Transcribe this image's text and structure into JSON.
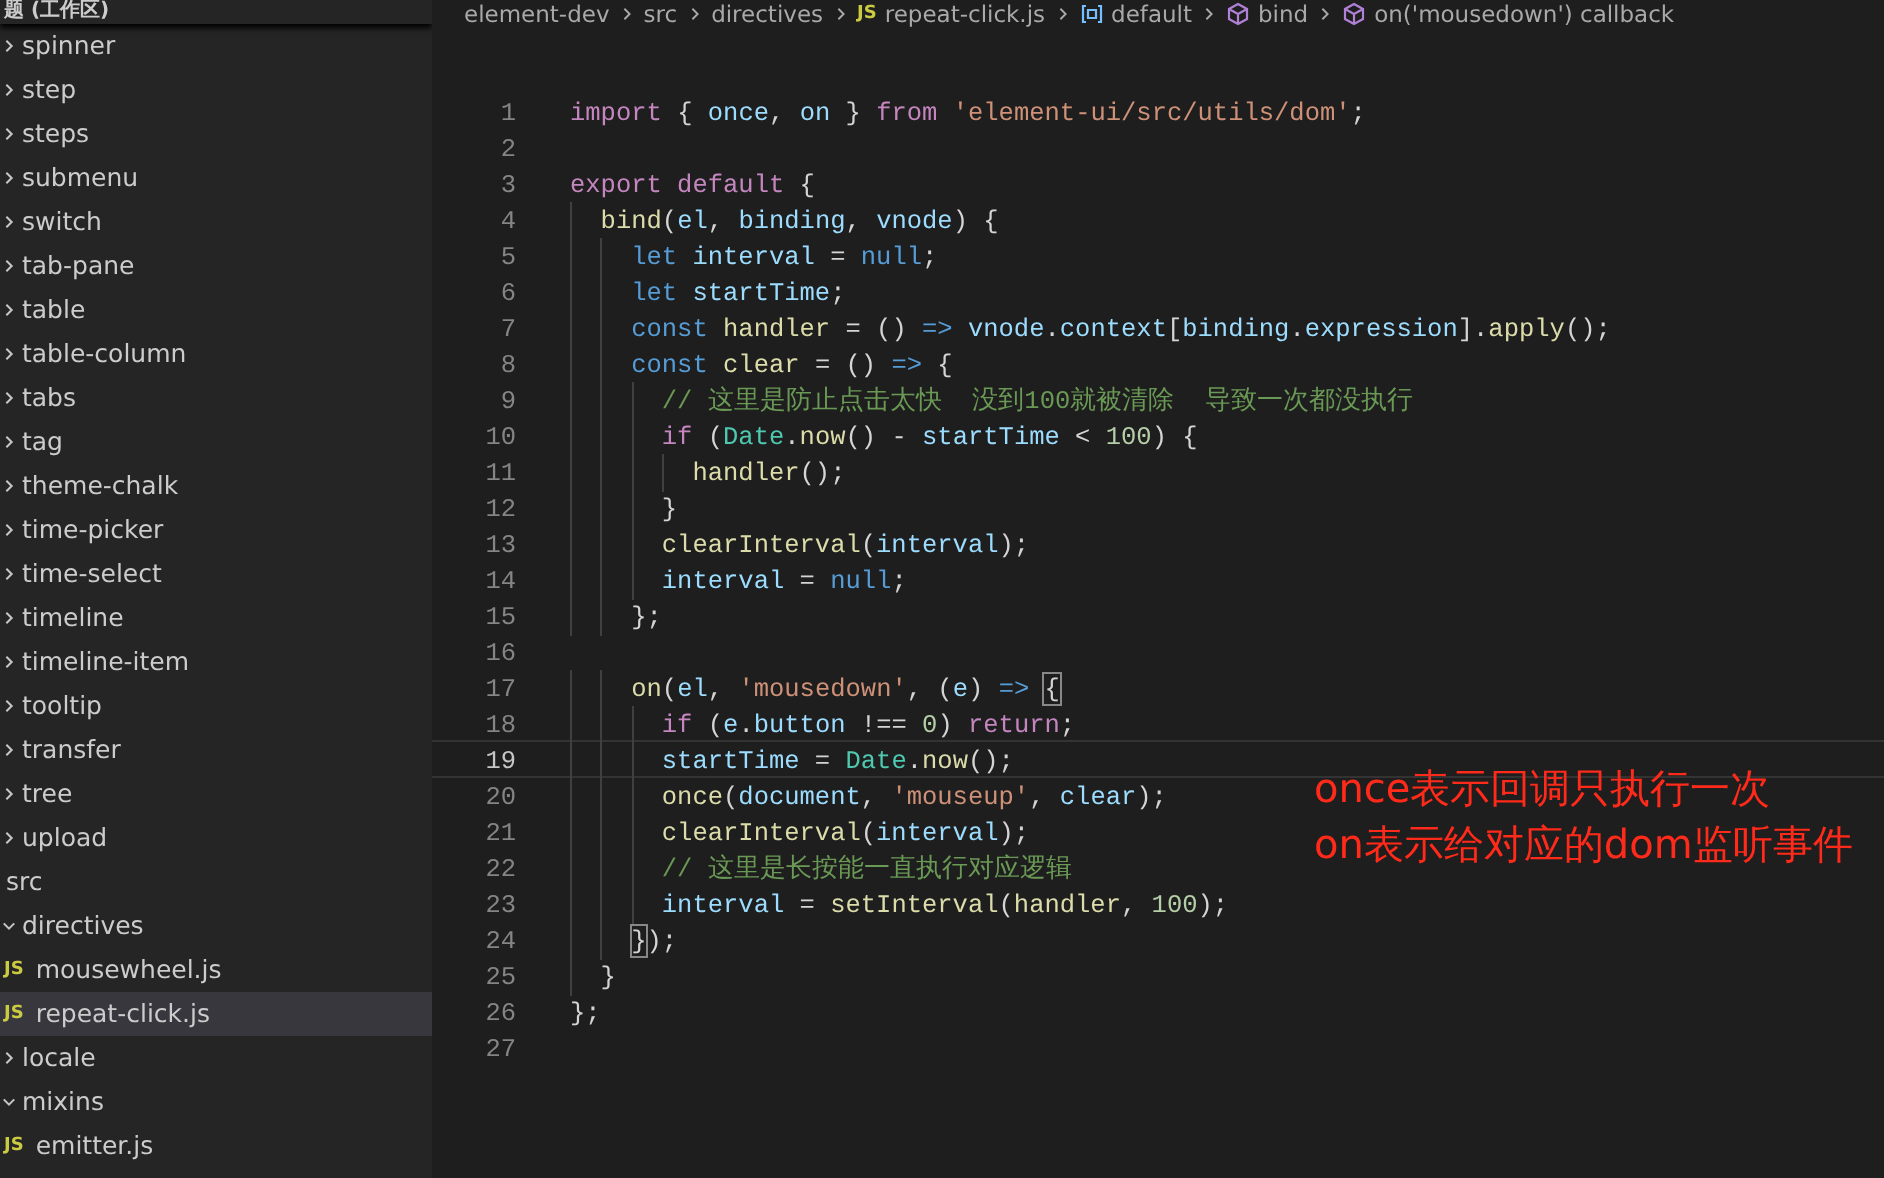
{
  "sidebar": {
    "header": "题 (工作区)",
    "tree_continued": [
      {
        "label": "spinner",
        "kind": "folder",
        "expanded": false,
        "selected": false
      },
      {
        "label": "step",
        "kind": "folder",
        "expanded": false,
        "selected": false
      },
      {
        "label": "steps",
        "kind": "folder",
        "expanded": false,
        "selected": false
      },
      {
        "label": "submenu",
        "kind": "folder",
        "expanded": false,
        "selected": false
      },
      {
        "label": "switch",
        "kind": "folder",
        "expanded": false,
        "selected": false
      },
      {
        "label": "tab-pane",
        "kind": "folder",
        "expanded": false,
        "selected": false
      },
      {
        "label": "table",
        "kind": "folder",
        "expanded": false,
        "selected": false
      },
      {
        "label": "table-column",
        "kind": "folder",
        "expanded": false,
        "selected": false
      },
      {
        "label": "tabs",
        "kind": "folder",
        "expanded": false,
        "selected": false
      },
      {
        "label": "tag",
        "kind": "folder",
        "expanded": false,
        "selected": false
      },
      {
        "label": "theme-chalk",
        "kind": "folder",
        "expanded": false,
        "selected": false
      },
      {
        "label": "time-picker",
        "kind": "folder",
        "expanded": false,
        "selected": false
      },
      {
        "label": "time-select",
        "kind": "folder",
        "expanded": false,
        "selected": false
      },
      {
        "label": "timeline",
        "kind": "folder",
        "expanded": false,
        "selected": false
      },
      {
        "label": "timeline-item",
        "kind": "folder",
        "expanded": false,
        "selected": false
      },
      {
        "label": "tooltip",
        "kind": "folder",
        "expanded": false,
        "selected": false
      },
      {
        "label": "transfer",
        "kind": "folder",
        "expanded": false,
        "selected": false
      },
      {
        "label": "tree",
        "kind": "folder",
        "expanded": false,
        "selected": false
      },
      {
        "label": "upload",
        "kind": "folder",
        "expanded": false,
        "selected": false
      }
    ],
    "tree": [
      {
        "label": "src",
        "kind": "root",
        "selected": false,
        "children": [
          {
            "label": "directives",
            "kind": "folder",
            "expanded": true,
            "selected": false,
            "children": [
              {
                "label": "mousewheel.js",
                "kind": "file",
                "icon": "JS",
                "selected": false
              },
              {
                "label": "repeat-click.js",
                "kind": "file",
                "icon": "JS",
                "selected": true
              }
            ]
          },
          {
            "label": "locale",
            "kind": "folder",
            "expanded": false,
            "selected": false
          },
          {
            "label": "mixins",
            "kind": "folder",
            "expanded": true,
            "selected": false,
            "children": [
              {
                "label": "emitter.js",
                "kind": "file",
                "icon": "JS",
                "selected": false
              }
            ]
          }
        ]
      }
    ]
  },
  "breadcrumb": [
    {
      "label": "element-dev",
      "kind": "folder"
    },
    {
      "label": "src",
      "kind": "folder"
    },
    {
      "label": "directives",
      "kind": "folder"
    },
    {
      "label": "repeat-click.js",
      "kind": "file",
      "icon": "JS"
    },
    {
      "label": "default",
      "kind": "variable"
    },
    {
      "label": "bind",
      "kind": "method"
    },
    {
      "label": "on('mousedown') callback",
      "kind": "method"
    }
  ],
  "editor": {
    "lines": [
      {
        "number": "1",
        "current": false,
        "tokens": [
          {
            "kind": "keyword",
            "text": "import"
          },
          {
            "kind": "punctuation",
            "text": " { "
          },
          {
            "kind": "variable",
            "text": "once"
          },
          {
            "kind": "punctuation",
            "text": ", "
          },
          {
            "kind": "variable",
            "text": "on"
          },
          {
            "kind": "punctuation",
            "text": " } "
          },
          {
            "kind": "keyword",
            "text": "from"
          },
          {
            "kind": "string",
            "text": " 'element-ui/src/utils/dom'"
          },
          {
            "kind": "punctuation",
            "text": ";"
          }
        ]
      },
      {
        "number": "2",
        "current": false
      },
      {
        "number": "3",
        "current": false,
        "tokens": [
          {
            "kind": "keyword",
            "text": "export default"
          },
          {
            "kind": "punctuation",
            "text": " {"
          }
        ]
      },
      {
        "number": "4",
        "current": false,
        "tokens": [
          {
            "kind": "function",
            "text": "  bind"
          },
          {
            "kind": "punctuation",
            "text": "("
          },
          {
            "kind": "variable",
            "text": "el"
          },
          {
            "kind": "punctuation",
            "text": ", "
          },
          {
            "kind": "variable",
            "text": "binding"
          },
          {
            "kind": "punctuation",
            "text": ", "
          },
          {
            "kind": "variable",
            "text": "vnode"
          },
          {
            "kind": "punctuation",
            "text": ") {"
          }
        ]
      },
      {
        "number": "5",
        "current": false,
        "tokens": [
          {
            "kind": "storage",
            "text": "    let"
          },
          {
            "kind": "variable",
            "text": " interval"
          },
          {
            "kind": "punctuation",
            "text": " = "
          },
          {
            "kind": "storage",
            "text": "null"
          },
          {
            "kind": "punctuation",
            "text": ";"
          }
        ]
      },
      {
        "number": "6",
        "current": false,
        "tokens": [
          {
            "kind": "storage",
            "text": "    let"
          },
          {
            "kind": "variable",
            "text": " startTime"
          },
          {
            "kind": "punctuation",
            "text": ";"
          }
        ]
      },
      {
        "number": "7",
        "current": false,
        "tokens": [
          {
            "kind": "storage",
            "text": "    const"
          },
          {
            "kind": "function",
            "text": " handler"
          },
          {
            "kind": "punctuation",
            "text": " = () "
          },
          {
            "kind": "storage",
            "text": "=>"
          },
          {
            "kind": "variable",
            "text": " vnode"
          },
          {
            "kind": "punctuation",
            "text": "."
          },
          {
            "kind": "variable",
            "text": "context"
          },
          {
            "kind": "punctuation",
            "text": "["
          },
          {
            "kind": "variable",
            "text": "binding"
          },
          {
            "kind": "punctuation",
            "text": "."
          },
          {
            "kind": "variable",
            "text": "expression"
          },
          {
            "kind": "punctuation",
            "text": "]."
          },
          {
            "kind": "function",
            "text": "apply"
          },
          {
            "kind": "punctuation",
            "text": "();"
          }
        ]
      },
      {
        "number": "8",
        "current": false,
        "tokens": [
          {
            "kind": "storage",
            "text": "    const"
          },
          {
            "kind": "function",
            "text": " clear"
          },
          {
            "kind": "punctuation",
            "text": " = () "
          },
          {
            "kind": "storage",
            "text": "=>"
          },
          {
            "kind": "punctuation",
            "text": " {"
          }
        ]
      },
      {
        "number": "9",
        "current": false,
        "tokens": [
          {
            "kind": "comment",
            "text": "      // 这里是防止点击太快  没到100就被清除  导致一次都没执行"
          }
        ]
      },
      {
        "number": "10",
        "current": false,
        "tokens": [
          {
            "kind": "keyword",
            "text": "      if"
          },
          {
            "kind": "punctuation",
            "text": " ("
          },
          {
            "kind": "class",
            "text": "Date"
          },
          {
            "kind": "punctuation",
            "text": "."
          },
          {
            "kind": "function",
            "text": "now"
          },
          {
            "kind": "punctuation",
            "text": "() - "
          },
          {
            "kind": "variable",
            "text": "startTime"
          },
          {
            "kind": "punctuation",
            "text": " < "
          },
          {
            "kind": "number",
            "text": "100"
          },
          {
            "kind": "punctuation",
            "text": ") {"
          }
        ]
      },
      {
        "number": "11",
        "current": false,
        "tokens": [
          {
            "kind": "function",
            "text": "        handler"
          },
          {
            "kind": "punctuation",
            "text": "();"
          }
        ]
      },
      {
        "number": "12",
        "current": false,
        "tokens": [
          {
            "kind": "punctuation",
            "text": "      }"
          }
        ]
      },
      {
        "number": "13",
        "current": false,
        "tokens": [
          {
            "kind": "function",
            "text": "      clearInterval"
          },
          {
            "kind": "punctuation",
            "text": "("
          },
          {
            "kind": "variable",
            "text": "interval"
          },
          {
            "kind": "punctuation",
            "text": ");"
          }
        ]
      },
      {
        "number": "14",
        "current": false,
        "tokens": [
          {
            "kind": "variable",
            "text": "      interval"
          },
          {
            "kind": "punctuation",
            "text": " = "
          },
          {
            "kind": "storage",
            "text": "null"
          },
          {
            "kind": "punctuation",
            "text": ";"
          }
        ]
      },
      {
        "number": "15",
        "current": false,
        "tokens": [
          {
            "kind": "punctuation",
            "text": "    };"
          }
        ]
      },
      {
        "number": "16",
        "current": false
      },
      {
        "number": "17",
        "current": false,
        "tokens": [
          {
            "kind": "function",
            "text": "    on"
          },
          {
            "kind": "punctuation",
            "text": "("
          },
          {
            "kind": "variable",
            "text": "el"
          },
          {
            "kind": "punctuation",
            "text": ", "
          },
          {
            "kind": "string",
            "text": "'mousedown'"
          },
          {
            "kind": "punctuation",
            "text": ", ("
          },
          {
            "kind": "variable",
            "text": "e"
          },
          {
            "kind": "punctuation",
            "text": ") "
          },
          {
            "kind": "storage",
            "text": "=> "
          },
          {
            "kind": "bracket-match",
            "text": "{"
          }
        ]
      },
      {
        "number": "18",
        "current": false,
        "tokens": [
          {
            "kind": "keyword",
            "text": "      if"
          },
          {
            "kind": "punctuation",
            "text": " ("
          },
          {
            "kind": "variable",
            "text": "e"
          },
          {
            "kind": "punctuation",
            "text": "."
          },
          {
            "kind": "variable",
            "text": "button"
          },
          {
            "kind": "punctuation",
            "text": " !== "
          },
          {
            "kind": "number",
            "text": "0"
          },
          {
            "kind": "punctuation",
            "text": ") "
          },
          {
            "kind": "keyword",
            "text": "return"
          },
          {
            "kind": "punctuation",
            "text": ";"
          }
        ]
      },
      {
        "number": "19",
        "current": true,
        "tokens": [
          {
            "kind": "variable",
            "text": "      startTime"
          },
          {
            "kind": "punctuation",
            "text": " = "
          },
          {
            "kind": "class",
            "text": "Date"
          },
          {
            "kind": "punctuation",
            "text": "."
          },
          {
            "kind": "function",
            "text": "now"
          },
          {
            "kind": "punctuation",
            "text": "();"
          }
        ]
      },
      {
        "number": "20",
        "current": false,
        "tokens": [
          {
            "kind": "function",
            "text": "      once"
          },
          {
            "kind": "punctuation",
            "text": "("
          },
          {
            "kind": "variable",
            "text": "document"
          },
          {
            "kind": "punctuation",
            "text": ", "
          },
          {
            "kind": "string",
            "text": "'mouseup'"
          },
          {
            "kind": "punctuation",
            "text": ", "
          },
          {
            "kind": "variable",
            "text": "clear"
          },
          {
            "kind": "punctuation",
            "text": ");"
          }
        ]
      },
      {
        "number": "21",
        "current": false,
        "tokens": [
          {
            "kind": "function",
            "text": "      clearInterval"
          },
          {
            "kind": "punctuation",
            "text": "("
          },
          {
            "kind": "variable",
            "text": "interval"
          },
          {
            "kind": "punctuation",
            "text": ");"
          }
        ]
      },
      {
        "number": "22",
        "current": false,
        "tokens": [
          {
            "kind": "comment",
            "text": "      // 这里是长按能一直执行对应逻辑"
          }
        ]
      },
      {
        "number": "23",
        "current": false,
        "tokens": [
          {
            "kind": "variable",
            "text": "      interval"
          },
          {
            "kind": "punctuation",
            "text": " = "
          },
          {
            "kind": "function",
            "text": "setInterval"
          },
          {
            "kind": "punctuation",
            "text": "("
          },
          {
            "kind": "function",
            "text": "handler"
          },
          {
            "kind": "punctuation",
            "text": ", "
          },
          {
            "kind": "number",
            "text": "100"
          },
          {
            "kind": "punctuation",
            "text": ");"
          }
        ]
      },
      {
        "number": "24",
        "current": false,
        "tokens": [
          {
            "kind": "bracket-match",
            "text": "    }"
          },
          {
            "kind": "punctuation",
            "text": ");"
          }
        ]
      },
      {
        "number": "25",
        "current": false,
        "tokens": [
          {
            "kind": "punctuation",
            "text": "  }"
          }
        ]
      },
      {
        "number": "26",
        "current": false,
        "tokens": [
          {
            "kind": "punctuation",
            "text": "};"
          }
        ]
      },
      {
        "number": "27",
        "current": false
      }
    ]
  },
  "annotation": [
    "once表示回调只执行一次",
    "on表示给对应的dom监听事件"
  ]
}
